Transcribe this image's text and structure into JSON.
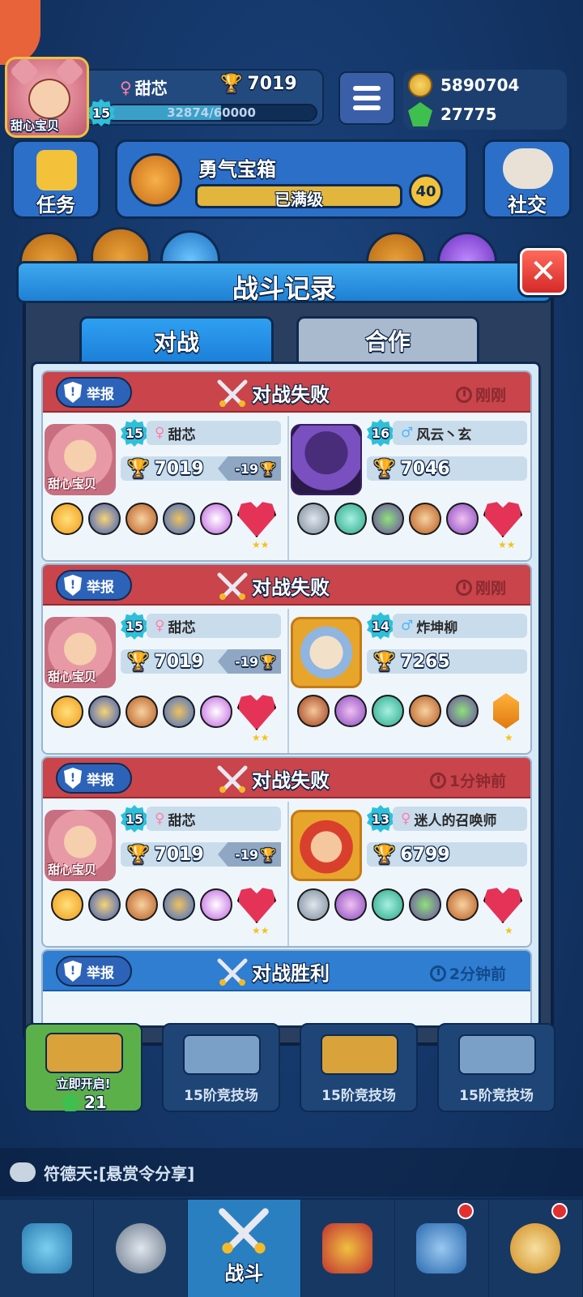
{
  "profile": {
    "name": "甜芯",
    "avatar_tag": "甜心宝贝",
    "level": "15",
    "trophies": "7019",
    "xp_text": "32874/60000",
    "xp_fraction": 0.548
  },
  "currency": {
    "coins": "5890704",
    "gems": "27775"
  },
  "top_buttons": {
    "tasks": "任务",
    "chest_title": "勇气宝箱",
    "chest_status": "已满级",
    "chest_count": "40",
    "social": "社交"
  },
  "modal": {
    "title": "战斗记录",
    "tabs": [
      "对战",
      "合作"
    ],
    "close_glyph": "✕"
  },
  "records": [
    {
      "report": "举报",
      "result": "对战失败",
      "outcome": "loss",
      "time": "刚刚",
      "me": {
        "level": "15",
        "name": "甜芯",
        "trophies": "7019",
        "delta": "-19",
        "avatar_tag": "甜心宝贝"
      },
      "opponent": {
        "level": "16",
        "name": "风云丶玄",
        "trophies": "7046"
      }
    },
    {
      "report": "举报",
      "result": "对战失败",
      "outcome": "loss",
      "time": "刚刚",
      "me": {
        "level": "15",
        "name": "甜芯",
        "trophies": "7019",
        "delta": "-19",
        "avatar_tag": "甜心宝贝"
      },
      "opponent": {
        "level": "14",
        "name": "炸坤柳",
        "trophies": "7265"
      }
    },
    {
      "report": "举报",
      "result": "对战失败",
      "outcome": "loss",
      "time": "1分钟前",
      "me": {
        "level": "15",
        "name": "甜芯",
        "trophies": "7019",
        "delta": "-19",
        "avatar_tag": "甜心宝贝"
      },
      "opponent": {
        "level": "13",
        "name": "迷人的召唤师",
        "trophies": "6799"
      }
    },
    {
      "report": "举报",
      "result": "对战胜利",
      "outcome": "win",
      "time": "2分钟前"
    }
  ],
  "chest_slots": [
    {
      "label": "立即开启!",
      "cost": "21"
    },
    {
      "label": "15阶竞技场"
    },
    {
      "label": "15阶竞技场"
    },
    {
      "label": "15阶竞技场"
    }
  ],
  "chat": {
    "text": "符德天:[悬赏令分享]"
  },
  "nav": {
    "battle_label": "战斗"
  }
}
